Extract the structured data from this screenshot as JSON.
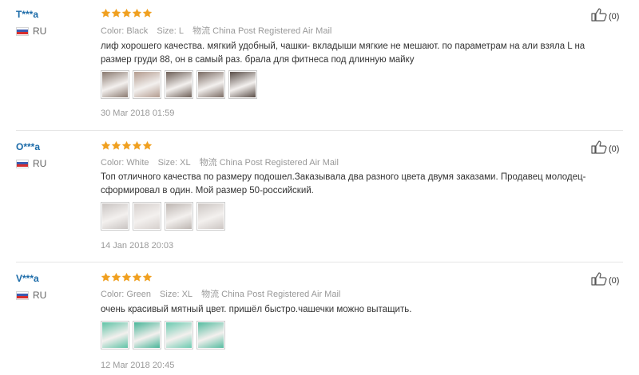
{
  "labels": {
    "color": "Color:",
    "size": "Size:",
    "logistics": "物流"
  },
  "reviews": [
    {
      "user": "T***a",
      "country": "RU",
      "rating": 5,
      "color": "Black",
      "size": "L",
      "shipping": "China Post Registered Air Mail",
      "text": "лиф хорошего качества. мягкий удобный, чашки- вкладыши мягкие не мешают. по параметрам на али взяла L на размер груди 88, он в самый раз. брала для фитнеса под длинную майку",
      "photos": [
        "photo-1",
        "photo-2",
        "photo-3",
        "photo-4",
        "photo-5"
      ],
      "date": "30 Mar 2018 01:59",
      "likes": "(0)"
    },
    {
      "user": "O***a",
      "country": "RU",
      "rating": 5,
      "color": "White",
      "size": "XL",
      "shipping": "China Post Registered Air Mail",
      "text": "Топ отличного качества по размеру подошел.Заказывала два разного цвета двумя заказами. Продавец молодец- сформировал в один. Мой размер 50-российский.",
      "photos": [
        "photo-1",
        "photo-2",
        "photo-3",
        "photo-4"
      ],
      "date": "14 Jan 2018 20:03",
      "likes": "(0)"
    },
    {
      "user": "V***a",
      "country": "RU",
      "rating": 5,
      "color": "Green",
      "size": "XL",
      "shipping": "China Post Registered Air Mail",
      "text": "очень красивый мятный цвет. пришёл быстро.чашечки можно вытащить.",
      "photos": [
        "photo-1",
        "photo-2",
        "photo-3",
        "photo-4"
      ],
      "date": "12 Mar 2018 20:45",
      "likes": "(0)"
    }
  ],
  "colors": {
    "star": "#f0a020",
    "username": "#1a6aa8",
    "photo_tones_1": [
      "#8a7a70",
      "#b39b8e",
      "#6d5f57",
      "#7a6b63",
      "#5a4e48"
    ],
    "photo_tones_2": [
      "#c9c4c2",
      "#d6d0cd",
      "#bdb6b2",
      "#ccc6c3"
    ],
    "photo_tones_3": [
      "#5fc3a6",
      "#48b598",
      "#6bcab0",
      "#55bca0"
    ]
  }
}
